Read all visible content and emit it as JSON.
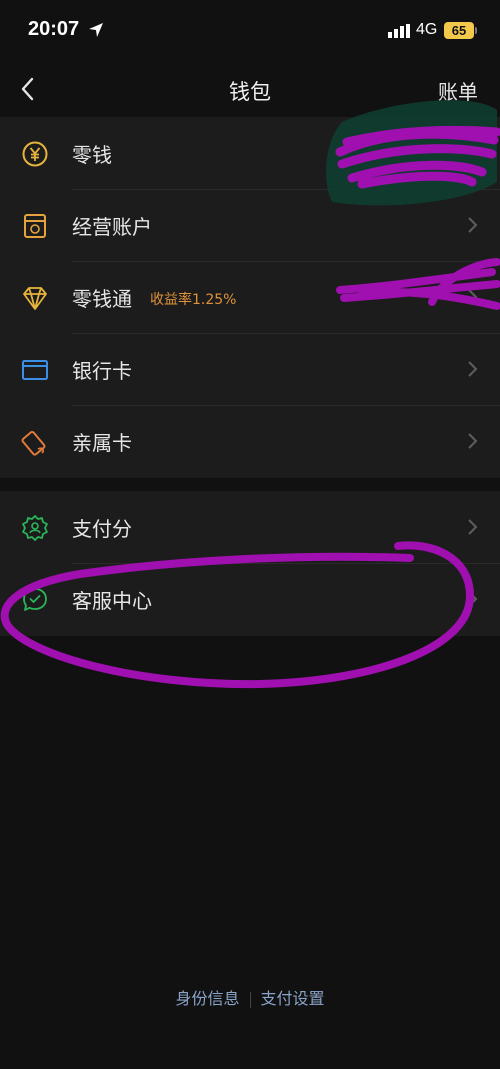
{
  "status": {
    "time": "20:07",
    "network": "4G",
    "battery": "65"
  },
  "nav": {
    "title": "钱包",
    "right": "账单"
  },
  "group1": [
    {
      "label": "零钱",
      "icon": "coin-yen-icon",
      "color": "#e6b43c"
    },
    {
      "label": "经营账户",
      "icon": "shop-icon",
      "color": "#e6a23c"
    },
    {
      "label": "零钱通",
      "icon": "diamond-icon",
      "color": "#e6b43c",
      "badge": "收益率1.25%"
    },
    {
      "label": "银行卡",
      "icon": "card-icon",
      "color": "#3b8fe6"
    },
    {
      "label": "亲属卡",
      "icon": "family-card-icon",
      "color": "#e07b3c"
    }
  ],
  "group2": [
    {
      "label": "支付分",
      "icon": "credit-score-icon",
      "color": "#2bb55a"
    },
    {
      "label": "客服中心",
      "icon": "customer-service-icon",
      "color": "#2bb55a"
    }
  ],
  "footer": {
    "left": "身份信息",
    "right": "支付设置"
  },
  "colors": {
    "background": "#111111",
    "row": "#1c1c1c",
    "accent_orange": "#e0923a",
    "link_blue": "#8aa4c8",
    "scribble_purple": "#a010b0"
  }
}
